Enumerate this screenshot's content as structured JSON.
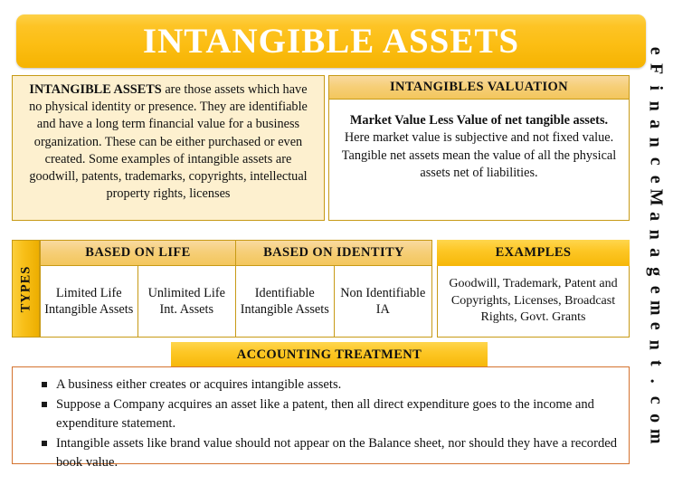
{
  "banner": {
    "title": "INTANGIBLE ASSETS"
  },
  "definition": {
    "lead": "INTANGIBLE ASSETS",
    "body": " are those assets which have no physical identity or presence. They are identifiable and have a long term financial value for a business organization. These can be either purchased or even created. Some examples of intangible assets are goodwill, patents, trademarks, copyrights, intellectual property rights, licenses"
  },
  "valuation": {
    "header": "INTANGIBLES VALUATION",
    "formula": "Market Value Less Value of net tangible assets.",
    "body": "Here market value is subjective and not fixed value. Tangible net assets mean the value of all the physical assets net of liabilities."
  },
  "types": {
    "label": "TYPES",
    "headers": [
      "BASED ON LIFE",
      "BASED ON IDENTITY"
    ],
    "cells": [
      "Limited Life Intangible Assets",
      "Unlimited Life Int. Assets",
      "Identifiable Intangible Assets",
      "Non Identifiable IA"
    ]
  },
  "examples": {
    "header": "EXAMPLES",
    "body": "Goodwill, Trademark, Patent and Copyrights, Licenses, Broadcast Rights, Govt. Grants"
  },
  "treatment": {
    "header": "ACCOUNTING TREATMENT",
    "bullets": [
      "A business either creates or acquires intangible assets.",
      "Suppose a Company acquires an asset like a patent, then all direct expenditure goes to the income and expenditure statement.",
      "Intangible assets like brand value should not appear on the Balance sheet, nor should they have a recorded book value."
    ]
  },
  "watermark": {
    "text": "eFinanceManagement.com"
  },
  "colors": {
    "gold_light": "#fdd147",
    "gold_deep": "#f5b301",
    "header_gold": "#f3c65c",
    "cream": "#fdf0cf",
    "border_gold": "#c79a16",
    "border_orange": "#d4732f",
    "title_text": "#ffffff"
  }
}
